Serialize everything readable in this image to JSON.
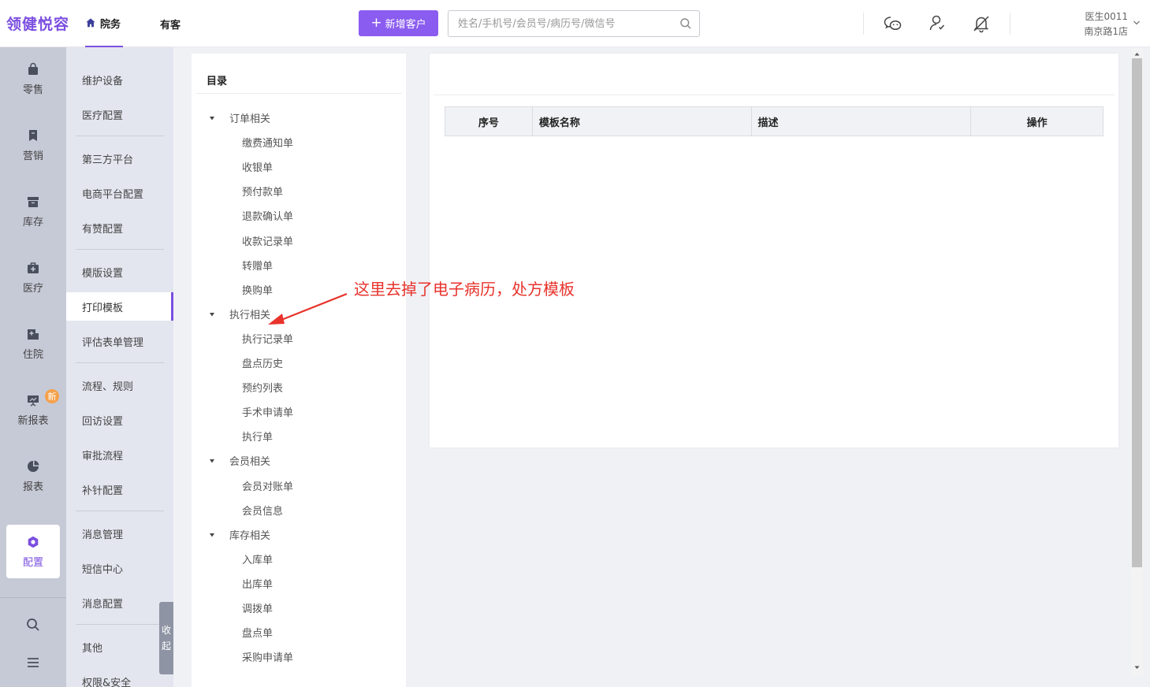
{
  "app": {
    "brand": "领健悦容"
  },
  "topnav": {
    "tabs": [
      {
        "label": "院务"
      },
      {
        "label": "有客"
      }
    ]
  },
  "actions": {
    "add_customer": "新增客户"
  },
  "search": {
    "placeholder": "姓名/手机号/会员号/病历号/微信号"
  },
  "header_icons": [
    "wechat-icon",
    "user-icon",
    "bell-off-icon"
  ],
  "user": {
    "name": "医生0011",
    "store": "南京路1店"
  },
  "rail": {
    "items": [
      {
        "label": "零售",
        "icon": "bag-icon"
      },
      {
        "label": "营销",
        "icon": "bookmark-icon"
      },
      {
        "label": "库存",
        "icon": "box-icon"
      },
      {
        "label": "医疗",
        "icon": "medkit-icon"
      },
      {
        "label": "住院",
        "icon": "hospital-icon"
      },
      {
        "label": "新报表",
        "icon": "presentation-icon",
        "badge": "新"
      },
      {
        "label": "报表",
        "icon": "pie-icon"
      },
      {
        "label": "配置",
        "icon": "settings-icon",
        "active": true
      }
    ],
    "tools": [
      "search-icon",
      "menu-icon"
    ]
  },
  "submenu": {
    "items": [
      "维护设备",
      "医疗配置",
      "第三方平台",
      "电商平台配置",
      "有赞配置",
      "模版设置",
      "打印模板",
      "评估表单管理",
      "流程、规则",
      "回访设置",
      "审批流程",
      "补针配置",
      "消息管理",
      "短信中心",
      "消息配置",
      "其他",
      "权限&安全"
    ],
    "active": "打印模板",
    "collapse_label": [
      "收",
      "起"
    ]
  },
  "tree": {
    "title": "目录",
    "groups": [
      {
        "label": "订单相关",
        "children": [
          "缴费通知单",
          "收银单",
          "预付款单",
          "退款确认单",
          "收款记录单",
          "转赠单",
          "换购单"
        ]
      },
      {
        "label": "执行相关",
        "children": [
          "执行记录单",
          "盘点历史",
          "预约列表",
          "手术申请单",
          "执行单"
        ]
      },
      {
        "label": "会员相关",
        "children": [
          "会员对账单",
          "会员信息"
        ]
      },
      {
        "label": "库存相关",
        "children": [
          "入库单",
          "出库单",
          "调拨单",
          "盘点单",
          "采购申请单"
        ]
      }
    ]
  },
  "table": {
    "columns": [
      "序号",
      "模板名称",
      "描述",
      "操作"
    ]
  },
  "annotation": {
    "text": "这里去掉了电子病历，处方模板"
  },
  "colors": {
    "accent": "#7b4fe0",
    "button": "#8b5cf0",
    "annotation": "#e8332c",
    "rail": "#c6cad6",
    "submenu": "#e3e6ef"
  }
}
